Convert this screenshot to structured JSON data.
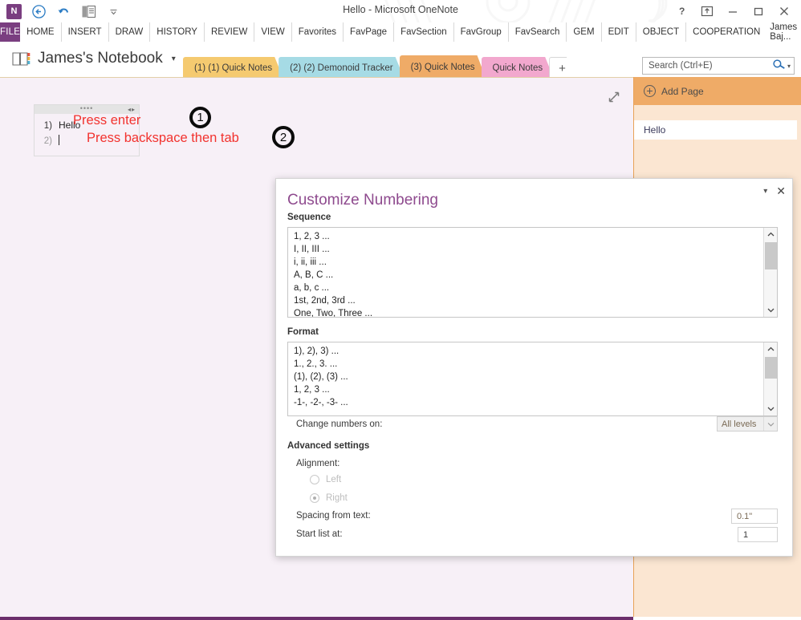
{
  "window": {
    "title": "Hello - Microsoft OneNote",
    "quick_access": [
      {
        "name": "onenote-logo-icon",
        "glyph": "N"
      },
      {
        "name": "back-icon",
        "glyph": "←"
      },
      {
        "name": "undo-icon",
        "glyph": "↶"
      },
      {
        "name": "dock-to-desktop-icon",
        "glyph": "▤"
      },
      {
        "name": "customize-quick-access-caret-icon",
        "glyph": "▾"
      }
    ],
    "controls": [
      {
        "name": "help-button",
        "glyph": "?"
      },
      {
        "name": "ribbon-display-options-button",
        "glyph": "⤒"
      },
      {
        "name": "minimize-button",
        "glyph": "—"
      },
      {
        "name": "maximize-button",
        "glyph": "□"
      },
      {
        "name": "close-button",
        "glyph": "✕"
      }
    ]
  },
  "ribbon": {
    "file_label": "FILE",
    "tabs": [
      "HOME",
      "INSERT",
      "DRAW",
      "HISTORY",
      "REVIEW",
      "VIEW",
      "Favorites",
      "FavPage",
      "FavSection",
      "FavGroup",
      "FavSearch",
      "GEM",
      "EDIT",
      "OBJECT",
      "COOPERATION"
    ],
    "account_name": "James Baj...",
    "account_caret": "▾"
  },
  "notebook": {
    "name": "James's Notebook",
    "caret": "▾",
    "sections": [
      {
        "label": "(1) (1) Quick Notes",
        "color": "#f5ca70",
        "active": false
      },
      {
        "label": "(2) (2) Demonoid Tracker",
        "color": "#a6dbe5",
        "active": false
      },
      {
        "label": "(3) Quick Notes",
        "color": "#efab67",
        "active": true
      },
      {
        "label": "Quick Notes",
        "color": "#f2a8ce",
        "active": false
      }
    ],
    "add_section_label": "+"
  },
  "search": {
    "placeholder": "Search (Ctrl+E)",
    "value": "",
    "magnifier_icon": "⚲",
    "caret": "▾"
  },
  "canvas": {
    "expand_icon": "↗",
    "note": {
      "handle_dots": "••••",
      "handle_arrows": "◂▸",
      "lines": [
        {
          "number": "1)",
          "text": "Hello",
          "dim": false,
          "caret": false
        },
        {
          "number": "2)",
          "text": "",
          "dim": true,
          "caret": true
        }
      ]
    },
    "annotations": [
      {
        "name": "annotation-press-enter",
        "text": "Press enter",
        "badge": "1"
      },
      {
        "name": "annotation-press-backspace-then-tab",
        "text": "Press backspace then tab",
        "badge": "2"
      }
    ]
  },
  "page_list": {
    "add_page_label": "Add Page",
    "pages": [
      {
        "title": "Hello",
        "selected": true
      }
    ]
  },
  "dialog": {
    "title": "Customize Numbering",
    "collapse_caret": "▾",
    "close_glyph": "✕",
    "sequence_label": "Sequence",
    "sequence_items": [
      "1, 2, 3 ...",
      "I, II, III ...",
      "i, ii, iii ...",
      "A, B, C ...",
      "a, b, c ...",
      "1st, 2nd, 3rd ...",
      "One, Two, Three ..."
    ],
    "format_label": "Format",
    "format_items": [
      "1), 2), 3) ...",
      "1., 2., 3. ...",
      "(1), (2), (3) ...",
      "1, 2, 3 ...",
      "-1-, -2-, -3- ..."
    ],
    "change_numbers_label": "Change numbers on:",
    "change_numbers_value": "All levels",
    "change_numbers_caret": "▾",
    "advanced_label": "Advanced settings",
    "alignment_label": "Alignment:",
    "alignment_options": [
      {
        "label": "Left",
        "checked": false
      },
      {
        "label": "Right",
        "checked": true
      }
    ],
    "spacing_label": "Spacing from text:",
    "spacing_value": "0.1\"",
    "start_list_label": "Start list at:",
    "start_list_value": "1"
  },
  "colors": {
    "brand_purple": "#7a3e80",
    "dialog_title_purple": "#8e4a8e",
    "annotation_red": "#f2322e",
    "canvas_bg": "#f7f0f7",
    "page_list_bg": "#fbe6d2",
    "add_page_bg": "#efab67"
  }
}
